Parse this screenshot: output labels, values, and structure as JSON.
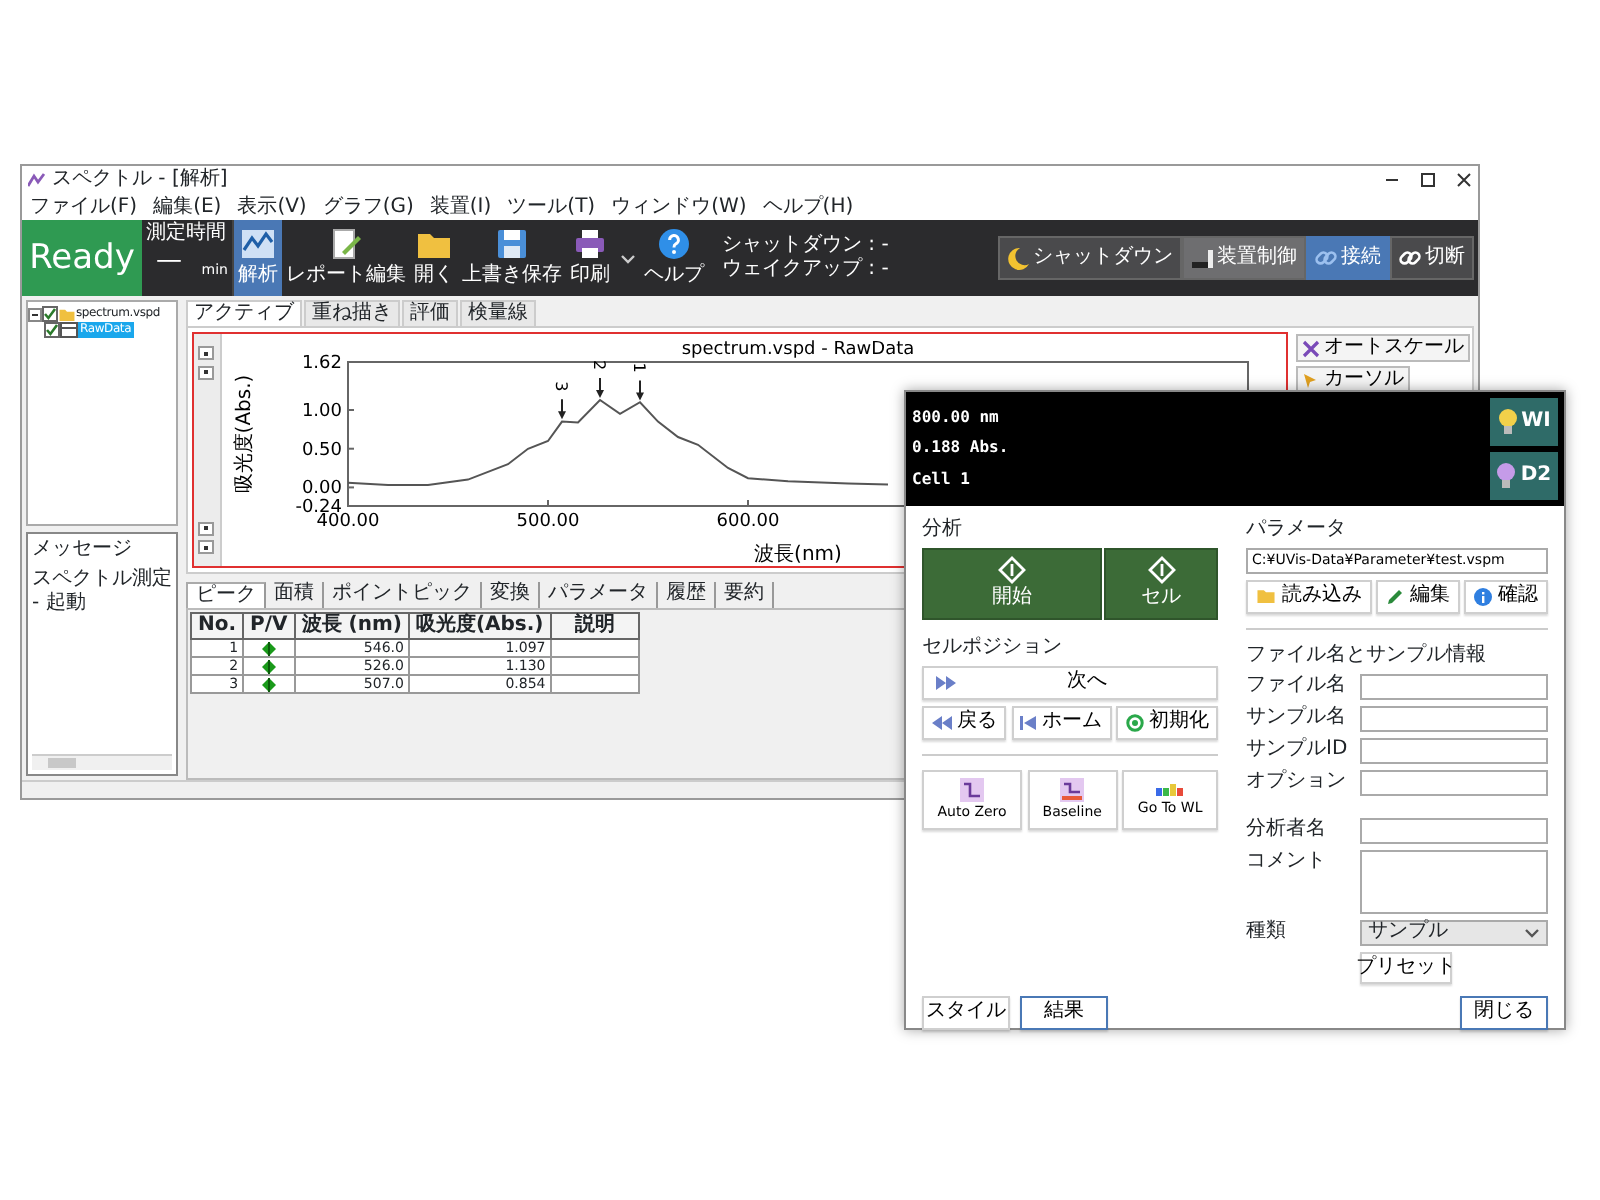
{
  "window": {
    "title": "スペクトル - [解析]"
  },
  "menu": [
    "ファイル(F)",
    "編集(E)",
    "表示(V)",
    "グラフ(G)",
    "装置(I)",
    "ツール(T)",
    "ウィンドウ(W)",
    "ヘルプ(H)"
  ],
  "toolbar": {
    "status": "Ready",
    "timer": {
      "label": "測定時間",
      "value": "—",
      "unit": "min"
    },
    "tools": [
      {
        "label": "解析",
        "kind": "analysis",
        "selected": true,
        "has_menu": false
      },
      {
        "label": "レポート編集",
        "kind": "report",
        "selected": false,
        "has_menu": false
      },
      {
        "label": "開く",
        "kind": "open",
        "selected": false,
        "has_menu": false
      },
      {
        "label": "上書き保存",
        "kind": "save",
        "selected": false,
        "has_menu": false
      },
      {
        "label": "印刷",
        "kind": "print",
        "selected": false,
        "has_menu": true
      },
      {
        "label": "ヘルプ",
        "kind": "help",
        "selected": false,
        "has_menu": false
      }
    ],
    "schedule": [
      "シャットダウン : -",
      "ウェイクアップ : -"
    ],
    "device_buttons": [
      {
        "label": "シャットダウン",
        "kind": "shutdown",
        "selected": false
      },
      {
        "label": "装置制御",
        "kind": "control",
        "selected": false
      },
      {
        "label": "接続",
        "kind": "connect",
        "selected": true
      },
      {
        "label": "切断",
        "kind": "disconnect",
        "selected": false
      }
    ]
  },
  "tree": [
    {
      "label": "spectrum.vspd",
      "checked": true,
      "expanded": true,
      "selected": false,
      "children": [
        {
          "label": "RawData",
          "checked": true,
          "selected": true
        }
      ]
    }
  ],
  "messages": {
    "title": "メッセージ",
    "items": [
      "スペクトル測定 - 起動"
    ]
  },
  "graph_tabs": [
    {
      "label": "アクティブ",
      "selected": true
    },
    {
      "label": "重ね描き",
      "selected": false
    },
    {
      "label": "評価",
      "selected": false
    },
    {
      "label": "検量線",
      "selected": false
    }
  ],
  "graph": {
    "chart_data": {
      "type": "line",
      "title": "spectrum.vspd - RawData",
      "xlabel": "波長(nm)",
      "ylabel": "吸光度(Abs.)",
      "x": [
        400,
        420,
        440,
        460,
        480,
        490,
        500,
        507,
        515,
        526,
        536,
        546,
        555,
        565,
        575,
        590,
        600,
        620,
        650,
        670
      ],
      "series": [
        {
          "color": "#555555",
          "values": [
            0.06,
            0.03,
            0.03,
            0.1,
            0.3,
            0.5,
            0.6,
            0.85,
            0.84,
            1.13,
            0.95,
            1.1,
            0.85,
            0.65,
            0.55,
            0.25,
            0.12,
            0.08,
            0.05,
            0.04
          ]
        }
      ],
      "xlim": [
        400,
        850
      ],
      "ylim": [
        -0.24,
        1.62
      ],
      "xticks": [
        {
          "value": 400,
          "label": "400.00"
        },
        {
          "value": 500,
          "label": "500.00"
        },
        {
          "value": 600,
          "label": "600.00"
        }
      ],
      "yticks": [
        {
          "value": 1.62,
          "label": "1.62"
        },
        {
          "value": 1.0,
          "label": "1.00"
        },
        {
          "value": 0.5,
          "label": "0.50"
        },
        {
          "value": 0.0,
          "label": "0.00"
        },
        {
          "value": -0.24,
          "label": "-0.24"
        }
      ],
      "annotations": [
        {
          "x": 546,
          "y": 1.097,
          "text": "1"
        },
        {
          "x": 526,
          "y": 1.13,
          "text": "2"
        },
        {
          "x": 507,
          "y": 0.854,
          "text": "3"
        }
      ]
    }
  },
  "graph_buttons": [
    {
      "label": "オートスケール",
      "kind": "autoscale"
    },
    {
      "label": "カーソル",
      "kind": "cursor"
    }
  ],
  "result_tabs": [
    {
      "label": "ピーク",
      "selected": true
    },
    {
      "label": "面積",
      "selected": false
    },
    {
      "label": "ポイントピック",
      "selected": false
    },
    {
      "label": "変換",
      "selected": false
    },
    {
      "label": "パラメータ",
      "selected": false
    },
    {
      "label": "履歴",
      "selected": false
    },
    {
      "label": "要約",
      "selected": false
    }
  ],
  "peak_table": {
    "columns": [
      "No.",
      "P/V",
      "波長 (nm)",
      "吸光度(Abs.)",
      "説明"
    ],
    "rows": [
      {
        "no": "1",
        "kind": "peak",
        "wavelength": "546.0",
        "absorbance": "1.097"
      },
      {
        "no": "2",
        "kind": "peak",
        "wavelength": "526.0",
        "absorbance": "1.130"
      },
      {
        "no": "3",
        "kind": "peak",
        "wavelength": "507.0",
        "absorbance": "0.854"
      }
    ]
  },
  "dialog": {
    "readout": [
      "800.00 nm",
      "0.188 Abs.",
      "Cell 1"
    ],
    "lamps": [
      {
        "label": "WI",
        "kind": "wi"
      },
      {
        "label": "D2",
        "kind": "d2"
      }
    ],
    "analysis": {
      "title": "分析",
      "buttons": [
        "開始",
        "セル"
      ]
    },
    "cell_position": {
      "title": "セルポジション",
      "next": "次へ",
      "buttons": [
        {
          "label": "戻る",
          "kind": "back"
        },
        {
          "label": "ホーム",
          "kind": "home"
        },
        {
          "label": "初期化",
          "kind": "reset"
        }
      ]
    },
    "tools": [
      {
        "label": "Auto Zero",
        "kind": "autozero"
      },
      {
        "label": "Baseline",
        "kind": "baseline"
      },
      {
        "label": "Go To WL",
        "kind": "gotowl"
      }
    ],
    "parameters": {
      "title": "パラメータ",
      "path": "C:¥UVis-Data¥Parameter¥test.vspm",
      "buttons": [
        {
          "label": "読み込み",
          "kind": "load"
        },
        {
          "label": "編集",
          "kind": "edit"
        },
        {
          "label": "確認",
          "kind": "info"
        }
      ]
    },
    "sample": {
      "title": "ファイル名とサンプル情報",
      "fields": [
        "ファイル名",
        "サンプル名",
        "サンプルID",
        "オプション"
      ],
      "operator": "分析者名",
      "comment": "コメント",
      "type": {
        "label": "種類",
        "value": "サンプル"
      },
      "preset": "プリセット"
    },
    "footer_left": [
      {
        "label": "スタイル",
        "primary": false
      },
      {
        "label": "結果",
        "primary": true
      }
    ],
    "footer_right": [
      {
        "label": "閉じる",
        "primary": true
      }
    ]
  }
}
